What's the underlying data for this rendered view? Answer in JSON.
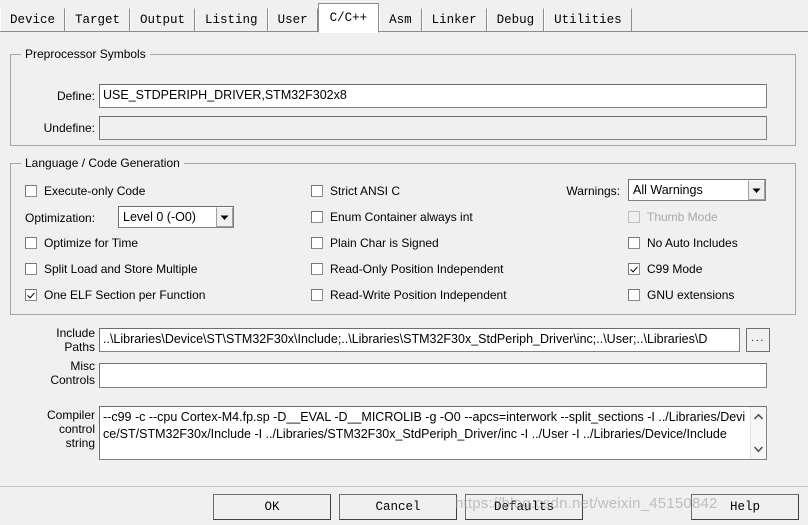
{
  "tabs": [
    {
      "label": "Device",
      "active": false
    },
    {
      "label": "Target",
      "active": false
    },
    {
      "label": "Output",
      "active": false
    },
    {
      "label": "Listing",
      "active": false
    },
    {
      "label": "User",
      "active": false
    },
    {
      "label": "C/C++",
      "active": true
    },
    {
      "label": "Asm",
      "active": false
    },
    {
      "label": "Linker",
      "active": false
    },
    {
      "label": "Debug",
      "active": false
    },
    {
      "label": "Utilities",
      "active": false
    }
  ],
  "preprocessor": {
    "group_title": "Preprocessor Symbols",
    "define_label": "Define:",
    "define_value": "USE_STDPERIPH_DRIVER,STM32F302x8",
    "undefine_label": "Undefine:",
    "undefine_value": ""
  },
  "language": {
    "group_title": "Language / Code Generation",
    "col1": [
      {
        "label": "Execute-only Code",
        "checked": false,
        "disabled": false
      },
      {
        "label": "Optimize for Time",
        "checked": false,
        "disabled": false
      },
      {
        "label": "Split Load and Store Multiple",
        "checked": false,
        "disabled": false
      },
      {
        "label": "One ELF Section per Function",
        "checked": true,
        "disabled": false
      }
    ],
    "optimization_label": "Optimization:",
    "optimization_value": "Level 0 (-O0)",
    "col2": [
      {
        "label": "Strict ANSI C",
        "checked": false,
        "disabled": false
      },
      {
        "label": "Enum Container always int",
        "checked": false,
        "disabled": false
      },
      {
        "label": "Plain Char is Signed",
        "checked": false,
        "disabled": false
      },
      {
        "label": "Read-Only Position Independent",
        "checked": false,
        "disabled": false
      },
      {
        "label": "Read-Write Position Independent",
        "checked": false,
        "disabled": false
      }
    ],
    "warnings_label": "Warnings:",
    "warnings_value": "All Warnings",
    "col3": [
      {
        "label": "Thumb Mode",
        "checked": false,
        "disabled": true
      },
      {
        "label": "No Auto Includes",
        "checked": false,
        "disabled": false
      },
      {
        "label": "C99 Mode",
        "checked": true,
        "disabled": false
      },
      {
        "label": "GNU extensions",
        "checked": false,
        "disabled": false
      }
    ]
  },
  "paths": {
    "include_label_line1": "Include",
    "include_label_line2": "Paths",
    "include_value": "..\\Libraries\\Device\\ST\\STM32F30x\\Include;..\\Libraries\\STM32F30x_StdPeriph_Driver\\inc;..\\User;..\\Libraries\\D",
    "browse_label": "...",
    "misc_label_line1": "Misc",
    "misc_label_line2": "Controls",
    "misc_value": "",
    "compiler_label_line1": "Compiler",
    "compiler_label_line2": "control",
    "compiler_label_line3": "string",
    "compiler_value": "--c99 -c --cpu Cortex-M4.fp.sp -D__EVAL -D__MICROLIB -g -O0 --apcs=interwork --split_sections -I ../Libraries/Device/ST/STM32F30x/Include -I ../Libraries/STM32F30x_StdPeriph_Driver/inc -I ../User -I ../Libraries/Device/Include"
  },
  "buttons": {
    "ok": "OK",
    "cancel": "Cancel",
    "defaults": "Defaults",
    "help": "Help"
  },
  "watermark": "https://blog.csdn.net/weixin_45150842",
  "colors": {
    "dialog_bg": "#f0f0f0",
    "field_bg": "#ffffff",
    "border": "#828282",
    "group_border": "#a6a6a6",
    "disabled_text": "#a8a8a8"
  }
}
